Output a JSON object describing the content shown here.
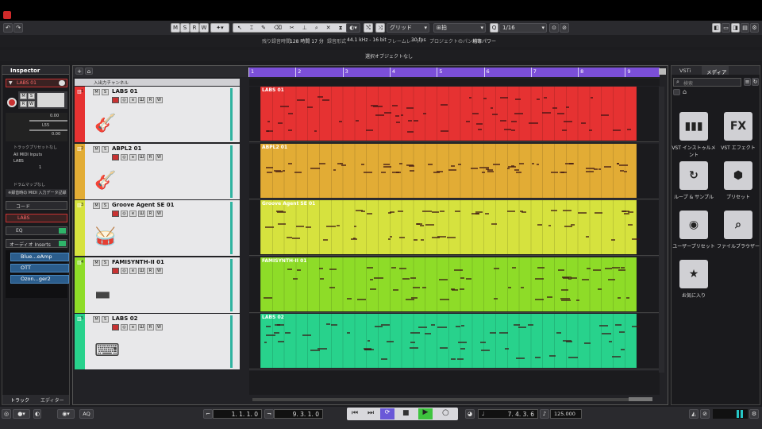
{
  "toolbar": {
    "modes": [
      "M",
      "S",
      "R",
      "W"
    ],
    "snap_label": "グリッド",
    "quantize_label": "拍",
    "quantize_value": "1/16"
  },
  "info": {
    "rec_time_label": "残り録音時間",
    "rec_time_value": "128 時間 17 分",
    "format_label": "録音形式",
    "format_value": "44.1 kHz - 16 bit",
    "framerate_label": "フレームレート",
    "framerate_value": "30 fps",
    "pan_label": "プロジェクトのパン補正",
    "pan_value": "均等パワー"
  },
  "status": {
    "selection": "選択オブジェクトなし"
  },
  "inspector": {
    "tab": "Inspector",
    "track_name": "LABS 01",
    "volume": "0.00",
    "pan": "L55",
    "pan_val": "0.00",
    "preset": "トラックプリセットなし",
    "midi_input": "All MIDI Inputs",
    "instrument": "LABS",
    "channel": "1",
    "drum_map": "ドラムマップなし",
    "midi_record": "※録音時の MIDI 入力データ記録",
    "sections": {
      "chord": "コード",
      "instrument": "LABS",
      "eq": "EQ",
      "inserts": "オーディオ Inserts"
    },
    "inserts": [
      "Blue...eAmp",
      "OTT",
      "Ozon...ger2"
    ],
    "bottom_tabs": [
      "トラック",
      "エディター"
    ]
  },
  "ruler": {
    "bars": [
      "1",
      "2",
      "3",
      "4",
      "5",
      "6",
      "7",
      "8",
      "9"
    ]
  },
  "tracks_header": "入出力チャンネル",
  "tracks": [
    {
      "num": "1",
      "name": "LABS 01",
      "part": "LABS 01",
      "color": "#e63232",
      "strip": "#e63232"
    },
    {
      "num": "2",
      "name": "ABPL2 01",
      "part": "ABPL2 01",
      "color": "#e2ac35",
      "strip": "#e2ac35"
    },
    {
      "num": "3",
      "name": "Groove Agent SE 01",
      "part": "Groove Agent SE 01",
      "color": "#d6e23e",
      "strip": "#d6e23e"
    },
    {
      "num": "4",
      "name": "FAMISYNTH-II 01",
      "part": "FAMISYNTH-II 01",
      "color": "#8edc28",
      "strip": "#8edc28"
    },
    {
      "num": "5",
      "name": "LABS 02",
      "part": "LABS 02",
      "color": "#28d28c",
      "strip": "#28d28c"
    }
  ],
  "right": {
    "tabs": [
      "VSTi",
      "メディア"
    ],
    "search_placeholder": "検索",
    "tiles": [
      {
        "label": "VST インストゥルメント",
        "icon": "piano-icon"
      },
      {
        "label": "VST エフェクト",
        "icon": "fx-icon"
      },
      {
        "label": "ループ & サンプル",
        "icon": "loop-icon"
      },
      {
        "label": "プリセット",
        "icon": "preset-icon"
      },
      {
        "label": "ユーザープリセット",
        "icon": "user-preset-icon"
      },
      {
        "label": "ファイルブラウザー",
        "icon": "file-browser-icon"
      },
      {
        "label": "お気に入り",
        "icon": "star-icon"
      }
    ]
  },
  "transport": {
    "left_locator": "1. 1. 1.  0",
    "right_locator": "9. 3. 1.  0",
    "position": "7. 4. 3.  6",
    "tempo": "125.000",
    "aq": "AQ"
  }
}
